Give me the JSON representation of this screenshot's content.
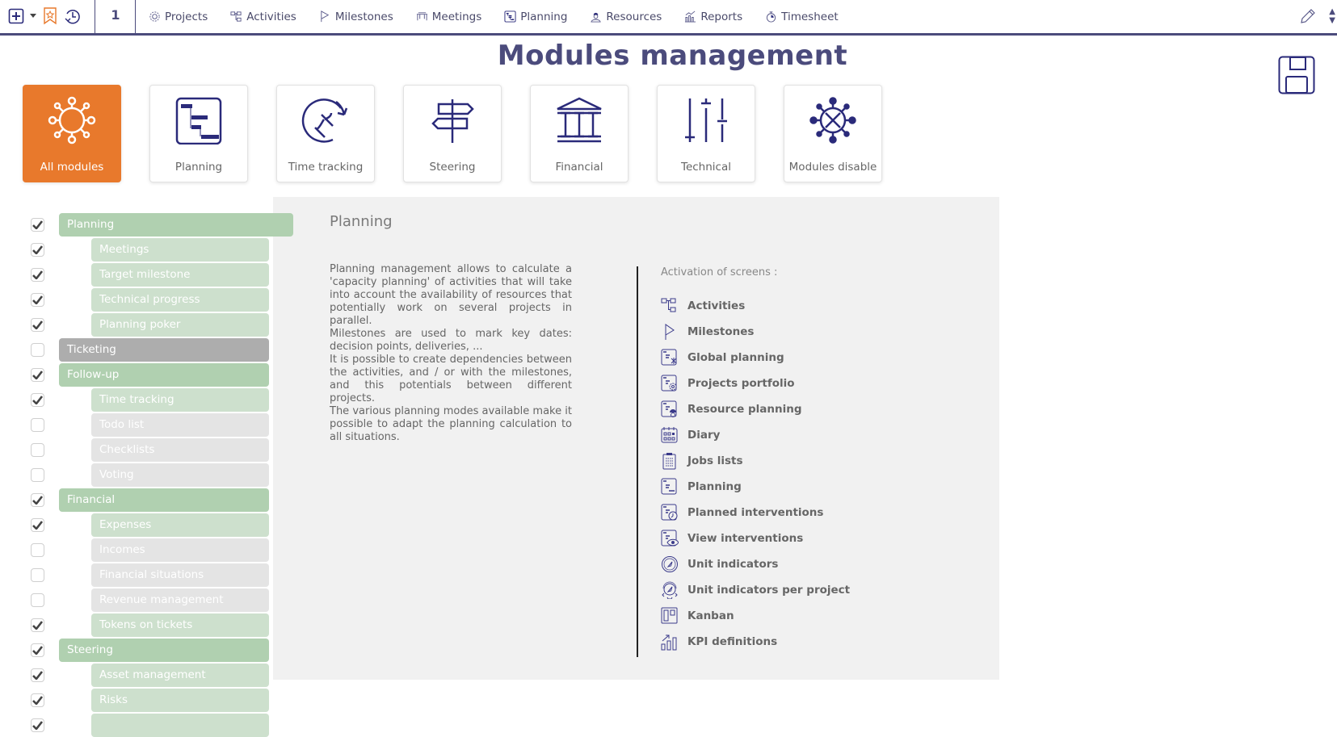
{
  "topbar": {
    "icons": [
      "add-icon",
      "dropdown-arrow-icon",
      "bookmark-star-icon",
      "history-icon"
    ],
    "count": "1",
    "menu": [
      {
        "label": "Projects",
        "icon": "gear-icon"
      },
      {
        "label": "Activities",
        "icon": "activities-icon"
      },
      {
        "label": "Milestones",
        "icon": "flag-icon"
      },
      {
        "label": "Meetings",
        "icon": "table-icon"
      },
      {
        "label": "Planning",
        "icon": "gantt-icon"
      },
      {
        "label": "Resources",
        "icon": "worker-icon"
      },
      {
        "label": "Reports",
        "icon": "chart-icon"
      },
      {
        "label": "Timesheet",
        "icon": "stopwatch-icon"
      }
    ],
    "right_icons": [
      "pencil-icon",
      "sort-arrows-icon"
    ]
  },
  "page": {
    "title": "Modules management",
    "save_icon": "floppy-disk-icon"
  },
  "colors": {
    "accent": "#e8792c",
    "navy": "#4b4b7c",
    "icon_navy": "#2a2a7a",
    "group_on": "#b0d0b0",
    "sub_on": "#cde0cd",
    "group_off": "#adadad",
    "sub_off": "#e4e4e4",
    "panel_bg": "#f1f1f1"
  },
  "categories": [
    {
      "label": "All modules",
      "icon": "network-icon",
      "active": true
    },
    {
      "label": "Planning",
      "icon": "gantt-icon",
      "active": false
    },
    {
      "label": "Time tracking",
      "icon": "hourglass-cycle-icon",
      "active": false
    },
    {
      "label": "Steering",
      "icon": "signpost-icon",
      "active": false
    },
    {
      "label": "Financial",
      "icon": "bank-icon",
      "active": false
    },
    {
      "label": "Technical",
      "icon": "sliders-icon",
      "active": false
    },
    {
      "label": "Modules disable",
      "icon": "network-disabled-icon",
      "active": false
    }
  ],
  "modules": [
    {
      "label": "Planning",
      "level": "group",
      "checked": true,
      "selected": true
    },
    {
      "label": "Meetings",
      "level": "sub",
      "checked": true
    },
    {
      "label": "Target milestone",
      "level": "sub",
      "checked": true
    },
    {
      "label": "Technical progress",
      "level": "sub",
      "checked": true
    },
    {
      "label": "Planning poker",
      "level": "sub",
      "checked": true
    },
    {
      "label": "Ticketing",
      "level": "group",
      "checked": false
    },
    {
      "label": "Follow-up",
      "level": "group",
      "checked": true
    },
    {
      "label": "Time tracking",
      "level": "sub",
      "checked": true
    },
    {
      "label": "Todo list",
      "level": "sub",
      "checked": false
    },
    {
      "label": "Checklists",
      "level": "sub",
      "checked": false
    },
    {
      "label": "Voting",
      "level": "sub",
      "checked": false
    },
    {
      "label": "Financial",
      "level": "group",
      "checked": true
    },
    {
      "label": "Expenses",
      "level": "sub",
      "checked": true
    },
    {
      "label": "Incomes",
      "level": "sub",
      "checked": false
    },
    {
      "label": "Financial situations",
      "level": "sub",
      "checked": false
    },
    {
      "label": "Revenue management",
      "level": "sub",
      "checked": false
    },
    {
      "label": "Tokens on tickets",
      "level": "sub",
      "checked": true
    },
    {
      "label": "Steering",
      "level": "group",
      "checked": true
    },
    {
      "label": "Asset management",
      "level": "sub",
      "checked": true
    },
    {
      "label": "Risks",
      "level": "sub",
      "checked": true
    },
    {
      "label": "",
      "level": "sub",
      "checked": true
    }
  ],
  "detail": {
    "title": "Planning",
    "paragraphs": [
      "Planning management allows to calculate a 'capacity planning' of activities that will take into account the availability of resources that potentially work on several projects in parallel.",
      "Milestones are used to mark key dates: decision points, deliveries, ...",
      "It is possible to create dependencies between the activities, and / or with the milestones, and this potentials between different projects.",
      "The various planning modes available make it possible to adapt the planning calculation to all situations."
    ],
    "screens_title": "Activation of screens :",
    "screens": [
      {
        "label": "Activities",
        "icon": "activities-icon"
      },
      {
        "label": "Milestones",
        "icon": "flag-icon"
      },
      {
        "label": "Global planning",
        "icon": "global-planning-icon"
      },
      {
        "label": "Projects portfolio",
        "icon": "portfolio-icon"
      },
      {
        "label": "Resource planning",
        "icon": "resource-planning-icon"
      },
      {
        "label": "Diary",
        "icon": "calendar-icon"
      },
      {
        "label": "Jobs lists",
        "icon": "clipboard-icon"
      },
      {
        "label": "Planning",
        "icon": "gantt-icon"
      },
      {
        "label": "Planned interventions",
        "icon": "planned-interventions-icon"
      },
      {
        "label": "View interventions",
        "icon": "view-interventions-icon"
      },
      {
        "label": "Unit indicators",
        "icon": "gauge-icon"
      },
      {
        "label": "Unit indicators per project",
        "icon": "gauge-gear-icon"
      },
      {
        "label": "Kanban",
        "icon": "kanban-icon"
      },
      {
        "label": "KPI definitions",
        "icon": "kpi-chart-icon"
      }
    ]
  }
}
